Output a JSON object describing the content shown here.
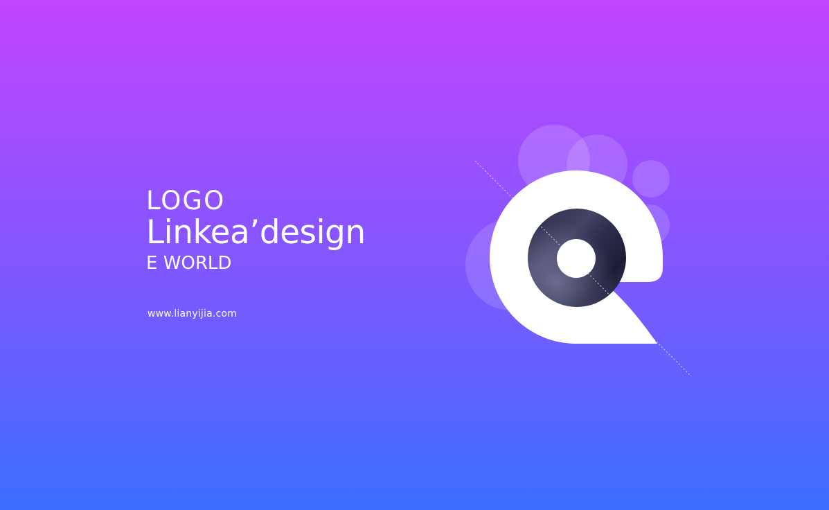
{
  "logo_word": "LOGO",
  "brand_name": "Linkea’design",
  "tagline": "E WORLD",
  "website": "www.lianyijia.com",
  "colors": {
    "gradient_top": "#c244ff",
    "gradient_bottom": "#3b6fff",
    "text": "#ffffff",
    "mark_fill": "#ffffff",
    "disc_dark": "#1c1c36",
    "disc_light": "#5d5e82"
  },
  "icons": {
    "brand_mark": "letter-e-with-disc-icon"
  }
}
